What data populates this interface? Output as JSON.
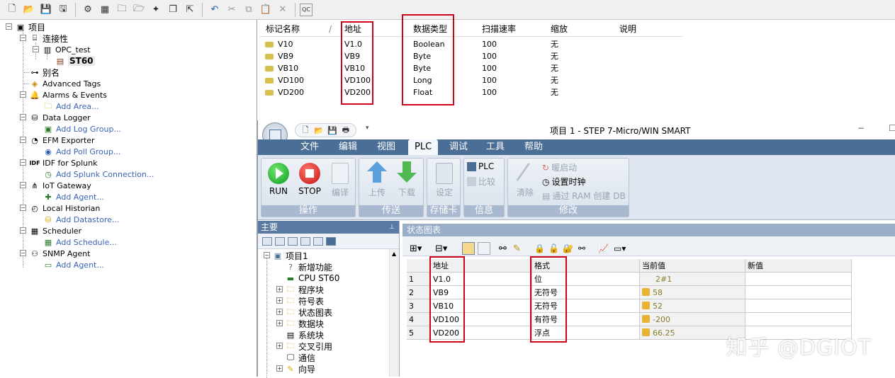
{
  "toolbar": {
    "items": [
      "new-icon",
      "open-icon",
      "save-icon",
      "save-as-icon",
      "settings-gear-icon",
      "grid-icon",
      "folder-add-icon",
      "folder-icon",
      "tag-add-icon",
      "copy-doc-icon",
      "export-icon",
      "undo-icon",
      "cut-icon",
      "copy-icon",
      "paste-icon",
      "delete-icon",
      "quick-client-icon"
    ],
    "qc_label": "QC"
  },
  "tree": {
    "project": "项目",
    "connectivity": "连接性",
    "channel": "OPC_test",
    "device": "ST60",
    "alias": "别名",
    "advanced_tags": "Advanced Tags",
    "alarms": "Alarms & Events",
    "add_area": "Add Area...",
    "data_logger": "Data Logger",
    "add_log_group": "Add Log Group...",
    "efm": "EFM Exporter",
    "add_poll_group": "Add Poll Group...",
    "idf": "IDF for Splunk",
    "add_splunk": "Add Splunk Connection...",
    "iot": "IoT Gateway",
    "add_agent_iot": "Add Agent...",
    "local_historian": "Local Historian",
    "add_datastore": "Add Datastore...",
    "scheduler": "Scheduler",
    "add_schedule": "Add Schedule...",
    "snmp": "SNMP Agent",
    "add_agent_snmp": "Add Agent..."
  },
  "tag_table": {
    "headers": {
      "name": "标记名称",
      "address": "地址",
      "type": "数据类型",
      "rate": "扫描速率",
      "scaling": "缩放",
      "desc": "说明"
    },
    "rows": [
      {
        "name": "V10",
        "address": "V1.0",
        "type": "Boolean",
        "rate": "100",
        "scaling": "无"
      },
      {
        "name": "VB9",
        "address": "VB9",
        "type": "Byte",
        "rate": "100",
        "scaling": "无"
      },
      {
        "name": "VB10",
        "address": "VB10",
        "type": "Byte",
        "rate": "100",
        "scaling": "无"
      },
      {
        "name": "VD100",
        "address": "VD100",
        "type": "Long",
        "rate": "100",
        "scaling": "无"
      },
      {
        "name": "VD200",
        "address": "VD200",
        "type": "Float",
        "rate": "100",
        "scaling": "无"
      }
    ]
  },
  "step7": {
    "title": "项目 1 - STEP 7-Micro/WIN SMART",
    "tabs": [
      "文件",
      "编辑",
      "视图",
      "PLC",
      "调试",
      "工具",
      "帮助"
    ],
    "ribbon": {
      "run": "RUN",
      "stop": "STOP",
      "compile": "编译",
      "group_operate": "操作",
      "upload": "上传",
      "download": "下载",
      "group_transfer": "传送",
      "settings": "设定",
      "group_memcard": "存储卡",
      "plc_info": "PLC",
      "compare": "比较",
      "group_info": "信息",
      "clear": "清除",
      "warm_start": "暖启动",
      "set_clock": "设置时钟",
      "create_db": "通过 RAM 创建 DB",
      "group_modify": "修改"
    },
    "main_panel": {
      "title": "主要",
      "items": [
        "项目1",
        "新增功能",
        "CPU ST60",
        "程序块",
        "符号表",
        "状态图表",
        "数据块",
        "系统块",
        "交叉引用",
        "通信",
        "向导"
      ]
    },
    "status_chart": {
      "title": "状态图表",
      "headers": {
        "address": "地址",
        "format": "格式",
        "current": "当前值",
        "new": "新值"
      },
      "rows": [
        {
          "n": "1",
          "address": "V1.0",
          "format": "位",
          "current": "2#1"
        },
        {
          "n": "2",
          "address": "VB9",
          "format": "无符号",
          "current": "58"
        },
        {
          "n": "3",
          "address": "VB10",
          "format": "无符号",
          "current": "52"
        },
        {
          "n": "4",
          "address": "VD100",
          "format": "有符号",
          "current": "-200"
        },
        {
          "n": "5",
          "address": "VD200",
          "format": "浮点",
          "current": "66.25"
        }
      ]
    }
  },
  "watermark": "知乎 @DGIOT",
  "colors": {
    "highlight_box": "#d0021b",
    "ribbon_blue": "#4b6e96",
    "link": "#3a63b5"
  }
}
